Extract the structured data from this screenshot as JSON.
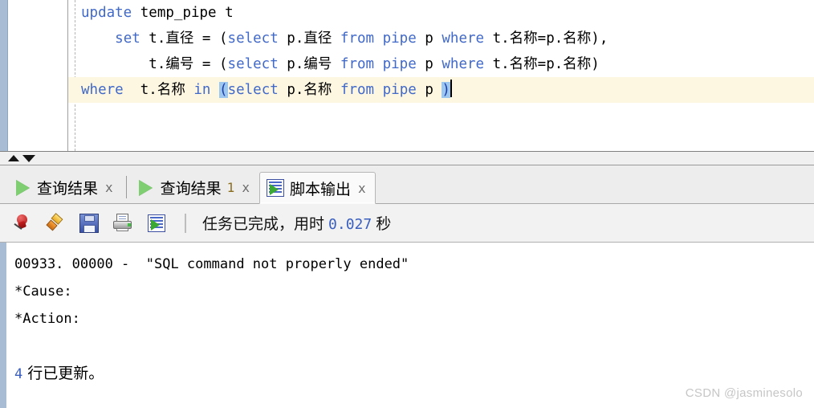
{
  "editor": {
    "lines": [
      {
        "indent": 0,
        "current": false,
        "tokens": [
          {
            "t": "update",
            "c": "kw"
          },
          {
            "t": " ",
            "c": "id"
          },
          {
            "t": "temp_pipe",
            "c": "id"
          },
          {
            "t": " ",
            "c": "id"
          },
          {
            "t": "t",
            "c": "id"
          }
        ]
      },
      {
        "indent": 0,
        "current": false,
        "tokens": [
          {
            "t": "    ",
            "c": "id"
          },
          {
            "t": "set",
            "c": "kw"
          },
          {
            "t": " t.",
            "c": "id"
          },
          {
            "t": "直径",
            "c": "id"
          },
          {
            "t": " = (",
            "c": "id"
          },
          {
            "t": "select",
            "c": "kw"
          },
          {
            "t": " p.",
            "c": "id"
          },
          {
            "t": "直径",
            "c": "id"
          },
          {
            "t": " ",
            "c": "id"
          },
          {
            "t": "from",
            "c": "kw"
          },
          {
            "t": " ",
            "c": "id"
          },
          {
            "t": "pipe",
            "c": "kw"
          },
          {
            "t": " p ",
            "c": "id"
          },
          {
            "t": "where",
            "c": "kw"
          },
          {
            "t": " t.",
            "c": "id"
          },
          {
            "t": "名称",
            "c": "id"
          },
          {
            "t": "=p.",
            "c": "id"
          },
          {
            "t": "名称",
            "c": "id"
          },
          {
            "t": "),",
            "c": "id"
          }
        ]
      },
      {
        "indent": 0,
        "current": false,
        "tokens": [
          {
            "t": "        ",
            "c": "id"
          },
          {
            "t": "t.",
            "c": "id"
          },
          {
            "t": "编号",
            "c": "id"
          },
          {
            "t": " = (",
            "c": "id"
          },
          {
            "t": "select",
            "c": "kw"
          },
          {
            "t": " p.",
            "c": "id"
          },
          {
            "t": "编号",
            "c": "id"
          },
          {
            "t": " ",
            "c": "id"
          },
          {
            "t": "from",
            "c": "kw"
          },
          {
            "t": " ",
            "c": "id"
          },
          {
            "t": "pipe",
            "c": "kw"
          },
          {
            "t": " p ",
            "c": "id"
          },
          {
            "t": "where",
            "c": "kw"
          },
          {
            "t": " t.",
            "c": "id"
          },
          {
            "t": "名称",
            "c": "id"
          },
          {
            "t": "=p.",
            "c": "id"
          },
          {
            "t": "名称",
            "c": "id"
          },
          {
            "t": ")",
            "c": "id"
          }
        ]
      },
      {
        "indent": 0,
        "current": true,
        "tokens": [
          {
            "t": "where",
            "c": "kw"
          },
          {
            "t": "  t.",
            "c": "id"
          },
          {
            "t": "名称",
            "c": "id"
          },
          {
            "t": " ",
            "c": "id"
          },
          {
            "t": "in",
            "c": "kw"
          },
          {
            "t": " ",
            "c": "id"
          },
          {
            "t": "(",
            "c": "brk-match"
          },
          {
            "t": "select",
            "c": "kw"
          },
          {
            "t": " p.",
            "c": "id"
          },
          {
            "t": "名称",
            "c": "id"
          },
          {
            "t": " ",
            "c": "id"
          },
          {
            "t": "from",
            "c": "kw"
          },
          {
            "t": " ",
            "c": "id"
          },
          {
            "t": "pipe",
            "c": "kw"
          },
          {
            "t": " p ",
            "c": "id"
          },
          {
            "t": ")",
            "c": "brk-match"
          }
        ],
        "caret": true
      }
    ]
  },
  "splitter": {
    "up_label": "collapse",
    "down_label": "expand"
  },
  "tabs": [
    {
      "label": "查询结果",
      "num": "",
      "close": "x",
      "icon": "play-icon",
      "active": false
    },
    {
      "label": "查询结果",
      "num": "1",
      "close": "x",
      "icon": "play-icon",
      "active": false
    },
    {
      "label": "脚本输出",
      "num": "",
      "close": "x",
      "icon": "script-output-icon",
      "active": true
    }
  ],
  "toolbar": {
    "buttons": [
      {
        "name": "pin-icon",
        "title": "固定"
      },
      {
        "name": "eraser-icon",
        "title": "清除"
      },
      {
        "name": "save-icon",
        "title": "保存"
      },
      {
        "name": "print-icon",
        "title": "打印"
      },
      {
        "name": "script-output-icon",
        "title": "脚本输出"
      }
    ],
    "status_prefix": "任务已完成，用时",
    "status_value": "0.027",
    "status_suffix": "秒"
  },
  "output": {
    "lines": [
      "00933. 00000 -  \"SQL command not properly ended\"",
      "*Cause:",
      "*Action:"
    ],
    "rows_count": "4",
    "rows_text": "行已更新。"
  },
  "watermark": "CSDN @jasminesolo",
  "colors": {
    "keyword": "#4169c8",
    "current_line": "#fdf6e0",
    "bracket_match": "#9ec7f0",
    "rail": "#a8bcd4",
    "accent_number": "#3b5fbf"
  }
}
